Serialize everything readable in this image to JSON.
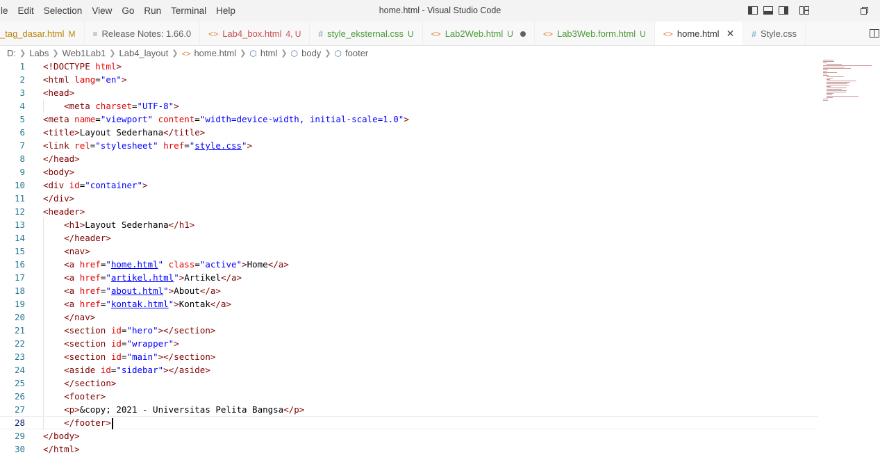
{
  "window": {
    "title": "home.html - Visual Studio Code"
  },
  "menu": [
    "le",
    "Edit",
    "Selection",
    "View",
    "Go",
    "Run",
    "Terminal",
    "Help"
  ],
  "tabs": [
    {
      "icon": "none",
      "label": "_tag_dasar.html",
      "badge": "M",
      "state": "mod"
    },
    {
      "icon": "notes",
      "label": "Release Notes: 1.66.0",
      "badge": "",
      "state": "none"
    },
    {
      "icon": "html",
      "label": "Lab4_box.html",
      "badge": "4, U",
      "state": "err"
    },
    {
      "icon": "css",
      "label": "style_eksternal.css",
      "badge": "U",
      "state": "untracked"
    },
    {
      "icon": "html",
      "label": "Lab2Web.html",
      "badge": "U",
      "state": "untracked",
      "dirty": true
    },
    {
      "icon": "html",
      "label": "Lab3Web.form.html",
      "badge": "U",
      "state": "untracked"
    },
    {
      "icon": "html",
      "label": "home.html",
      "badge": "",
      "state": "active"
    },
    {
      "icon": "css",
      "label": "Style.css",
      "badge": "",
      "state": "none"
    }
  ],
  "icons": {
    "html_tab": "angle-brackets-icon",
    "css_tab": "hash-icon",
    "notes_tab": "document-lines-icon",
    "close": "close-icon",
    "dirty": "dot-icon"
  },
  "breadcrumb": [
    "D:",
    "Labs",
    "Web1Lab1",
    "Lab4_layout",
    "home.html",
    "html",
    "body",
    "footer"
  ],
  "editor": {
    "current_line": 28,
    "lines": [
      "<!DOCTYPE html>",
      "<html lang=\"en\">",
      "<head>",
      "    <meta charset=\"UTF-8\">",
      "<meta name=\"viewport\" content=\"width=device-width, initial-scale=1.0\">",
      "<title>Layout Sederhana</title>",
      "<link rel=\"stylesheet\" href=\"style.css\">",
      "</head>",
      "<body>",
      "<div id=\"container\">",
      "</div>",
      "<header>",
      "    <h1>Layout Sederhana</h1>",
      "    </header>",
      "    <nav>",
      "    <a href=\"home.html\" class=\"active\">Home</a>",
      "    <a href=\"artikel.html\">Artikel</a>",
      "    <a href=\"about.html\">About</a>",
      "    <a href=\"kontak.html\">Kontak</a>",
      "    </nav>",
      "    <section id=\"hero\"></section>",
      "    <section id=\"wrapper\">",
      "    <section id=\"main\"></section>",
      "    <aside id=\"sidebar\"></aside>",
      "    </section>",
      "    <footer>",
      "    <p>&copy; 2021 - Universitas Pelita Bangsa</p>",
      "    </footer>",
      "</body>",
      "</html>"
    ]
  },
  "colors": {
    "tag": "#800000",
    "attr": "#e50000",
    "value": "#0000ff",
    "line_number": "#237893"
  }
}
